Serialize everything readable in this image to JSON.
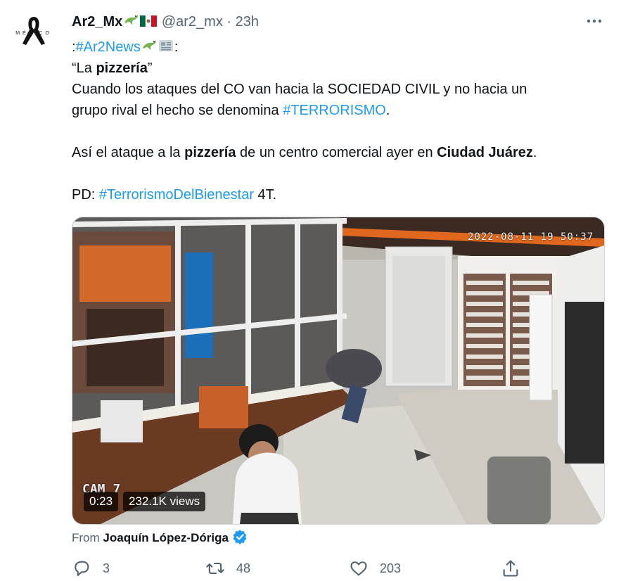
{
  "tweet": {
    "author_name": "Ar2_Mx",
    "author_emoji": [
      "lizard-emoji",
      "mexico-flag-emoji"
    ],
    "handle": "@ar2_mx",
    "separator": "·",
    "time": "23h",
    "avatar_text": "MÉXICO",
    "lines": {
      "l1_prefix": ":",
      "l1_hashtag": "#Ar2News",
      "l1_suffix": ":",
      "l2_open": "“La ",
      "l2_bold": "pizzería",
      "l2_close": "”",
      "l3": "Cuando los ataques del CO van hacia la SOCIEDAD CIVIL y no hacia un",
      "l4_text": "grupo rival el hecho se denomina ",
      "l4_hashtag": "#TERRORISMO",
      "l4_end": ".",
      "l5_a": "Así el ataque a la ",
      "l5_b": "pizzería",
      "l5_c": " de un centro comercial ayer en ",
      "l5_d": "Ciudad Juárez",
      "l5_e": ".",
      "l6_a": "PD: ",
      "l6_hashtag": "#TerrorismoDelBienestar",
      "l6_end": " 4T."
    }
  },
  "media": {
    "timestamp_overlay": "2022-08-11 19 50:37",
    "camera_label": "CAM 7",
    "duration": "0:23",
    "views": "232.1K views"
  },
  "source": {
    "label": "From",
    "name": "Joaquín López-Dóriga",
    "verified_icon": "verified-badge-icon"
  },
  "actions": {
    "reply_count": "3",
    "retweet_count": "48",
    "like_count": "203",
    "icons": [
      "reply-icon",
      "retweet-icon",
      "like-icon",
      "share-icon"
    ]
  },
  "colors": {
    "link": "#1d9bf0",
    "text": "#0f1419",
    "secondary": "#536471"
  }
}
